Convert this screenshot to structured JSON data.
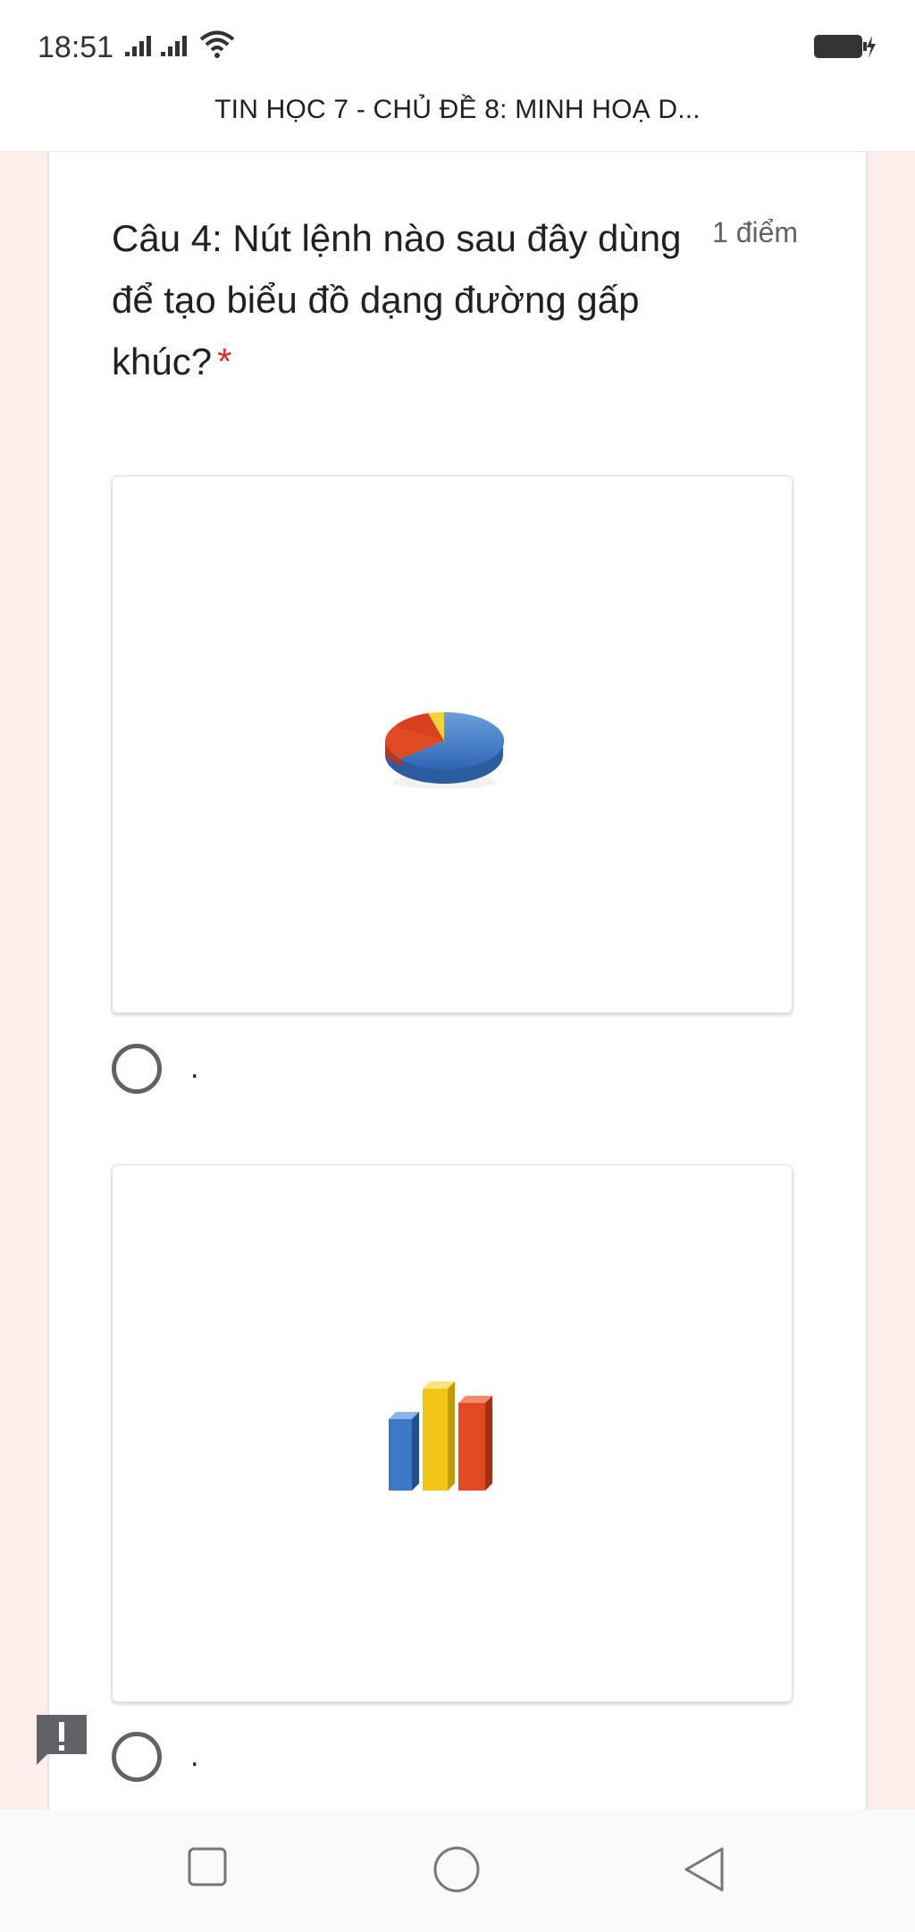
{
  "status_bar": {
    "time": "18:51",
    "icons": [
      "signal-icon",
      "signal-icon",
      "wifi-icon",
      "battery-charging-icon"
    ]
  },
  "header": {
    "title": "TIN HỌC 7 - CHỦ ĐỀ 8: MINH HOẠ D..."
  },
  "question": {
    "text": "Câu 4: Nút lệnh nào sau đây dùng để tạo biểu đồ dạng đường gấp khúc?",
    "required_mark": "*",
    "points": "1 điểm"
  },
  "options": [
    {
      "icon": "pie-chart-icon",
      "label": "."
    },
    {
      "icon": "bar-chart-icon",
      "label": "."
    }
  ],
  "feedback": {
    "icon": "feedback-icon"
  },
  "nav": {
    "icons": [
      "recent-apps-icon",
      "home-icon",
      "back-icon"
    ]
  },
  "colors": {
    "page_background": "#fdeeec",
    "card_background": "#ffffff",
    "required_red": "#d93025",
    "secondary_text": "#5f6368"
  }
}
